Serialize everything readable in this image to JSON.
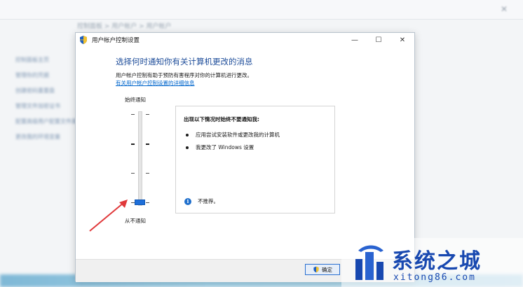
{
  "background": {
    "breadcrumb": "控制面板 > 用户帐户 > 用户帐户",
    "side_items": [
      "控制面板主页",
      "管理你的凭据",
      "创建密码重置盘",
      "管理文件加密证书",
      "配置高级用户配置文件属性",
      "更改我的环境变量"
    ]
  },
  "dialog": {
    "title": "用户帐户控制设置",
    "heading": "选择何时通知你有关计算机更改的消息",
    "description": "用户帐户控制有助于预防有害程序对你的计算机进行更改。",
    "help_link": "有关用户帐户控制设置的详细信息",
    "slider": {
      "top_label": "始终通知",
      "bottom_label": "从不通知",
      "levels": 4,
      "selected_level": 1
    },
    "info_box": {
      "title": "出现以下情况时始终不要通知我:",
      "bullets": [
        "应用尝试安装软件或更改我的计算机",
        "我更改了 Windows 设置"
      ],
      "note": "不推荐。"
    },
    "ok_label": "确定"
  },
  "watermark": {
    "name": "系统之城",
    "url": "xitong86.com"
  },
  "colors": {
    "heading": "#1e4d9a",
    "link": "#0066cc",
    "slider_thumb": "#1e6fd9",
    "arrow": "#e0383a",
    "watermark": "#1848b0"
  }
}
